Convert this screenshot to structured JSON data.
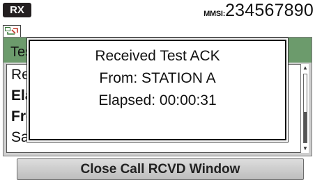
{
  "status_bar": {
    "rx_label": "RX",
    "mmsi_label": "MMSI:",
    "mmsi_value": "234567890"
  },
  "icons": {
    "comm_icon": "dsc-communication-icon"
  },
  "panel": {
    "title": "Tes",
    "items": [
      "Rec",
      "Ela",
      "Fro",
      "Saf"
    ]
  },
  "dialog": {
    "line1": "Received Test ACK",
    "line2": "From: STATION A",
    "line3": "Elapsed: 00:00:31"
  },
  "softkey": {
    "close_label": "Close Call RCVD Window"
  },
  "colors": {
    "header_green": "#6c9b6c",
    "panel_gray": "#cfcfcf",
    "badge_black": "#231f20"
  }
}
